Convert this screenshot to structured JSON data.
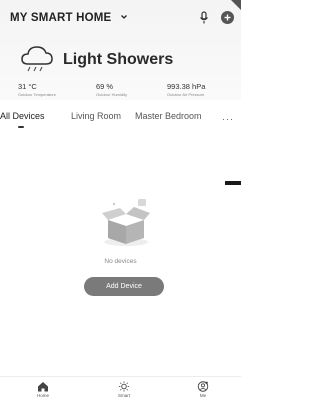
{
  "header": {
    "home_title": "MY SMART HOME",
    "icons": [
      "chevron-down-icon",
      "microphone-icon",
      "add-icon"
    ]
  },
  "weather": {
    "condition": "Light Showers",
    "icon": "cloud-rain-icon",
    "stats": [
      {
        "value": "31 °C",
        "label": "Outdoor Temperature"
      },
      {
        "value": "69 %",
        "label": "Outdoor Humidity"
      },
      {
        "value": "993.38 hPa",
        "label": "Outdoor Air Pressure"
      }
    ]
  },
  "tabs": {
    "items": [
      "All Devices",
      "Living Room",
      "Master Bedroom"
    ],
    "active": "All Devices",
    "more_label": "···"
  },
  "empty_state": {
    "message": "No devices",
    "icon": "empty-box-icon",
    "add_button": "Add Device",
    "button_color": "#7a7a7a"
  },
  "bottom_nav": [
    {
      "label": "Home",
      "icon": "home-icon"
    },
    {
      "label": "Smart",
      "icon": "sun-icon"
    },
    {
      "label": "Me",
      "icon": "profile-icon"
    }
  ]
}
